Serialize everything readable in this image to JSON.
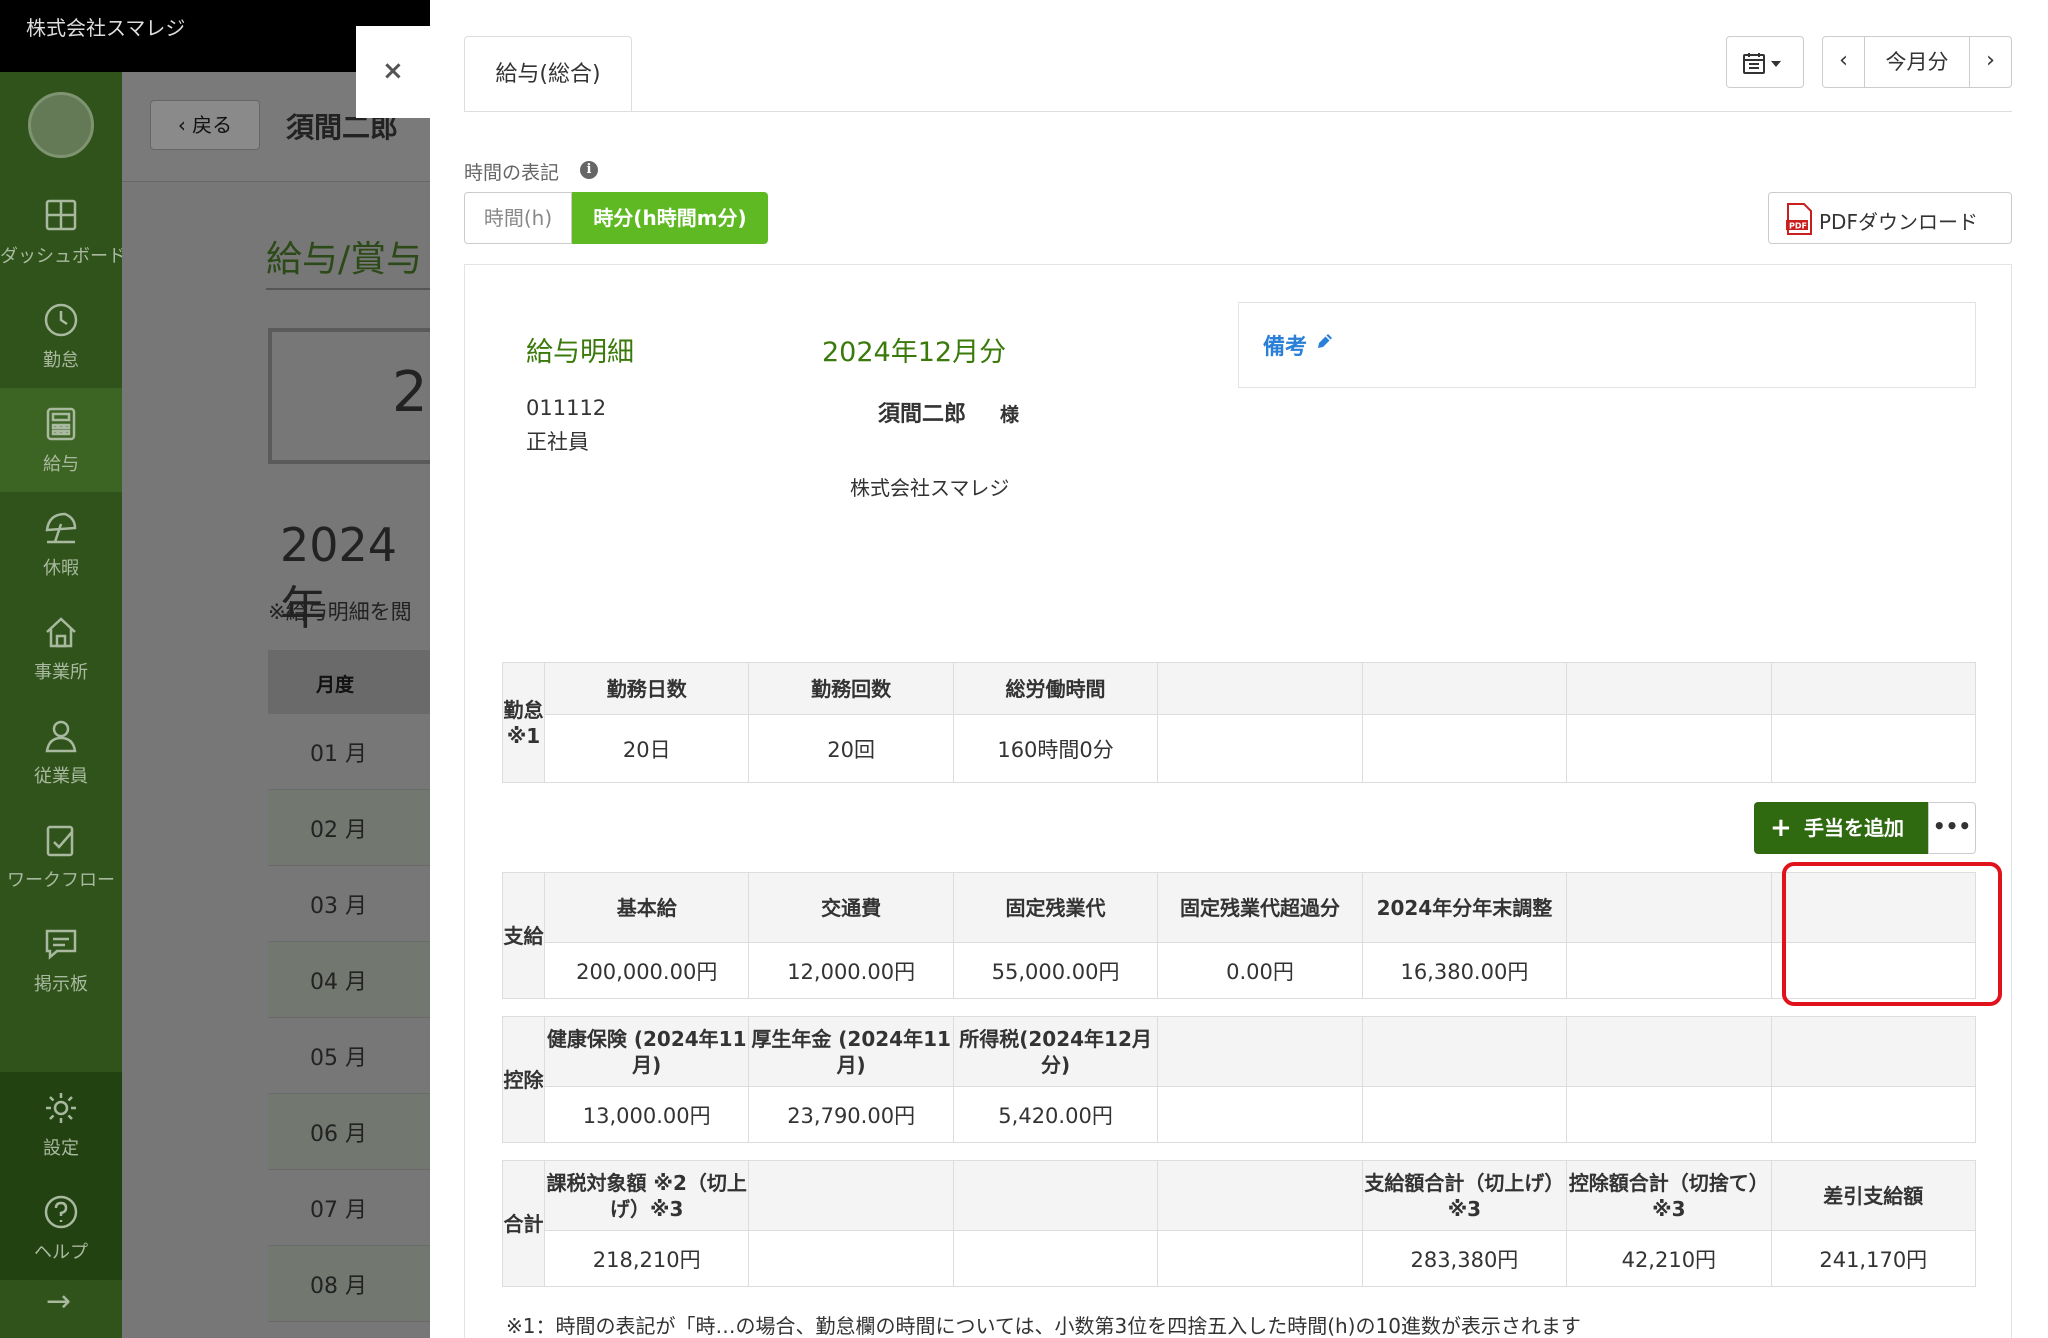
{
  "app": {
    "company_name": "株式会社スマレジ"
  },
  "sidebar": {
    "items": [
      {
        "label": "ダッシュボード",
        "icon": "dashboard-icon"
      },
      {
        "label": "勤怠",
        "icon": "clock-icon"
      },
      {
        "label": "給与",
        "icon": "calculator-icon"
      },
      {
        "label": "休暇",
        "icon": "umbrella-icon"
      },
      {
        "label": "事業所",
        "icon": "home-icon"
      },
      {
        "label": "従業員",
        "icon": "user-icon"
      },
      {
        "label": "ワークフロー",
        "icon": "clipboard-check-icon"
      },
      {
        "label": "掲示板",
        "icon": "message-icon"
      },
      {
        "label": "設定",
        "icon": "gear-icon"
      },
      {
        "label": "ヘルプ",
        "icon": "help-icon"
      }
    ],
    "active_item": "給与",
    "expand_arrow": "→"
  },
  "background": {
    "back_label": "戻る",
    "employee_name": "須間二郎",
    "section_title": "給与/賞与",
    "card_digit": "2",
    "year": "2024年",
    "note": "※給与明細を閲",
    "table_header": "月度",
    "months": [
      "01 月",
      "02 月",
      "03 月",
      "04 月",
      "05 月",
      "06 月",
      "07 月",
      "08 月"
    ]
  },
  "panel": {
    "close_icon": "×",
    "tab_label": "給与(総合)",
    "calendar_icon": "calendar-icon",
    "prev_label": "‹",
    "current_month_label": "今月分",
    "next_label": "›",
    "time_format_label": "時間の表記",
    "info_icon_label": "i",
    "toggle_hours": "時間(h)",
    "toggle_hm": "時分(h時間m分)",
    "pdf_label": "PDFダウンロード"
  },
  "slip": {
    "title": "給与明細",
    "month": "2024年12月分",
    "employee_code": "011112",
    "employment_type": "正社員",
    "employee_name": "須間二郎",
    "honorific": "様",
    "company": "株式会社スマレジ",
    "remarks_label": "備考"
  },
  "attendance": {
    "side_label": "勤怠※1",
    "headers": [
      "勤務日数",
      "勤務回数",
      "総労働時間",
      "",
      "",
      "",
      ""
    ],
    "values": [
      "20日",
      "20回",
      "160時間0分",
      "",
      "",
      "",
      ""
    ]
  },
  "add_allowance_label": "手当を追加",
  "more_label": "•••",
  "payments": {
    "side_label": "支給",
    "headers": [
      "基本給",
      "交通費",
      "固定残業代",
      "固定残業代超過分",
      "2024年分年末調整",
      "",
      ""
    ],
    "values": [
      "200,000.00円",
      "12,000.00円",
      "55,000.00円",
      "0.00円",
      "16,380.00円",
      "",
      ""
    ]
  },
  "deductions": {
    "side_label": "控除",
    "headers": [
      "健康保険 (2024年11月)",
      "厚生年金 (2024年11月)",
      "所得税(2024年12月分)",
      "",
      "",
      "",
      ""
    ],
    "values": [
      "13,000.00円",
      "23,790.00円",
      "5,420.00円",
      "",
      "",
      "",
      ""
    ]
  },
  "totals": {
    "side_label": "合計",
    "headers": [
      "課税対象額 ※2（切上げ）※3",
      "",
      "",
      "",
      "支給額合計（切上げ）※3",
      "控除額合計（切捨て）※3",
      "差引支給額"
    ],
    "values": [
      "218,210円",
      "",
      "",
      "",
      "283,380円",
      "42,210円",
      "241,170円"
    ]
  },
  "footnote": "※1：時間の表記が「時…の場合、勤怠欄の時間については、小数第3位を四捨五入した時間(h)の10進数が表示されます"
}
